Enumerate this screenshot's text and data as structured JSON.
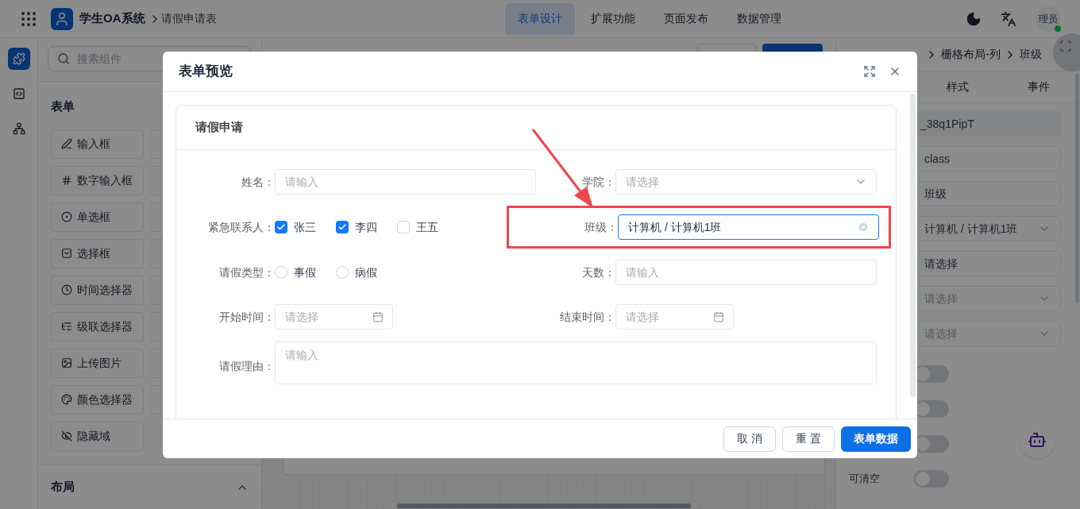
{
  "top_bar": {
    "app_name": "学生OA系统",
    "page": "请假申请表",
    "nav": [
      {
        "label": "表单设计",
        "selected": true
      },
      {
        "label": "扩展功能",
        "selected": false
      },
      {
        "label": "页面发布",
        "selected": false
      },
      {
        "label": "数据管理",
        "selected": false
      }
    ],
    "user": {
      "avatar_text": "理员",
      "online": true
    }
  },
  "rail": [
    {
      "kind": "components",
      "selected": true
    },
    {
      "kind": "code",
      "selected": false
    },
    {
      "kind": "tree",
      "selected": false
    }
  ],
  "component_panel": {
    "search_placeholder": "搜索组件",
    "form_group": {
      "title": "表单",
      "items": [
        {
          "label": "输入框",
          "kind": "input"
        },
        {
          "label": "数字输入框",
          "kind": "number"
        },
        {
          "label": "单选框",
          "kind": "radio"
        },
        {
          "label": "选择框",
          "kind": "select"
        },
        {
          "label": "时间选择器",
          "kind": "time"
        },
        {
          "label": "级联选择器",
          "kind": "cascader"
        },
        {
          "label": "上传图片",
          "kind": "image"
        },
        {
          "label": "颜色选择器",
          "kind": "color"
        },
        {
          "label": "隐藏域",
          "kind": "hidden"
        }
      ]
    },
    "layout_group": {
      "title": "布局",
      "expanded": true
    }
  },
  "properties_panel": {
    "breadcrumb": [
      "栅格布局-列",
      "班级"
    ],
    "tabs": [
      {
        "label": "样式",
        "selected": false
      },
      {
        "label": "事件",
        "selected": false
      }
    ],
    "fields": [
      {
        "kind": "readonly",
        "value": "_38q1PipT"
      },
      {
        "kind": "input",
        "value": "class"
      },
      {
        "kind": "input",
        "value": "班级"
      },
      {
        "kind": "select",
        "value": "计算机 / 计算机1班"
      },
      {
        "kind": "input",
        "value": "请选择"
      },
      {
        "kind": "select",
        "placeholder": "请选择"
      },
      {
        "kind": "select",
        "placeholder": "请选择"
      }
    ],
    "switches": [
      {
        "on": false
      },
      {
        "on": false
      },
      {
        "on": false
      },
      {
        "label": "可清空",
        "on": false
      }
    ]
  },
  "preview_dialog": {
    "title": "表单预览",
    "card_title": "请假申请",
    "fields": [
      {
        "kind": "input",
        "label": "姓名：",
        "placeholder": "请输入"
      },
      {
        "kind": "select",
        "label": "学院：",
        "placeholder": "请选择"
      },
      {
        "kind": "checkboxes",
        "label": "紧急联系人：",
        "options": [
          {
            "label": "张三",
            "checked": true
          },
          {
            "label": "李四",
            "checked": true
          },
          {
            "label": "王五",
            "checked": false
          }
        ]
      },
      {
        "kind": "cascader",
        "label": "班级：",
        "value": "计算机 / 计算机1班",
        "highlighted": true
      },
      {
        "kind": "radios",
        "label": "请假类型：",
        "options": [
          {
            "label": "事假",
            "selected": false
          },
          {
            "label": "病假",
            "selected": false
          }
        ]
      },
      {
        "kind": "input",
        "label": "天数：",
        "placeholder": "请输入"
      },
      {
        "kind": "date",
        "label": "开始时间：",
        "placeholder": "请选择"
      },
      {
        "kind": "date",
        "label": "结束时间：",
        "placeholder": "请选择"
      },
      {
        "kind": "textarea",
        "label": "请假理由：",
        "placeholder": "请输入"
      }
    ],
    "buttons": [
      {
        "label": "取 消",
        "primary": false
      },
      {
        "label": "重 置",
        "primary": false
      },
      {
        "label": "表单数据",
        "primary": true
      }
    ]
  }
}
